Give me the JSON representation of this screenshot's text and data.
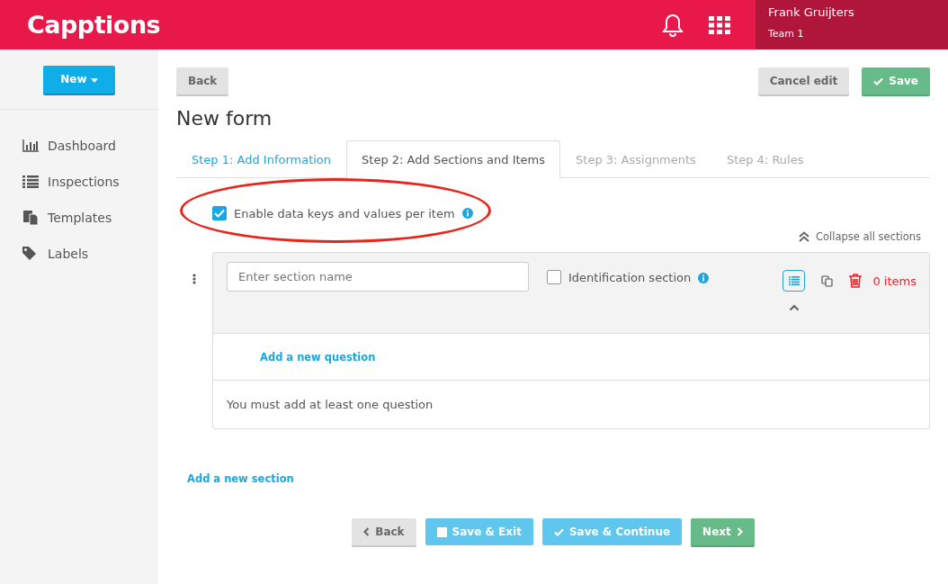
{
  "header": {
    "logo": "Capptions",
    "user": {
      "name": "Frank Gruijters",
      "team": "Team 1"
    }
  },
  "sidebar": {
    "new_button": "New",
    "items": [
      {
        "label": "Dashboard",
        "kind": "chart"
      },
      {
        "label": "Inspections",
        "kind": "list"
      },
      {
        "label": "Templates",
        "kind": "copy"
      },
      {
        "label": "Labels",
        "kind": "tag"
      }
    ]
  },
  "toolbar": {
    "back": "Back",
    "cancel": "Cancel edit",
    "save": "Save"
  },
  "title": "New form",
  "tabs": [
    {
      "label": "Step 1: Add Information",
      "selected": false,
      "disabled": false
    },
    {
      "label": "Step 2: Add Sections and Items",
      "selected": true,
      "disabled": false
    },
    {
      "label": "Step 3: Assignments",
      "selected": false,
      "disabled": true
    },
    {
      "label": "Step 4: Rules",
      "selected": false,
      "disabled": true
    }
  ],
  "data_keys": {
    "label": "Enable data keys and values per item",
    "checked": true
  },
  "collapse_all": "Collapse all sections",
  "section": {
    "placeholder": "Enter section name",
    "identification": {
      "label": "Identification section",
      "checked": false
    },
    "item_count": "0 items",
    "add_question": "Add a new question",
    "warning": "You must add at least one question"
  },
  "add_section": "Add a new section",
  "footer": {
    "back": "Back",
    "save_exit": "Save & Exit",
    "save_continue": "Save & Continue",
    "next": "Next"
  }
}
